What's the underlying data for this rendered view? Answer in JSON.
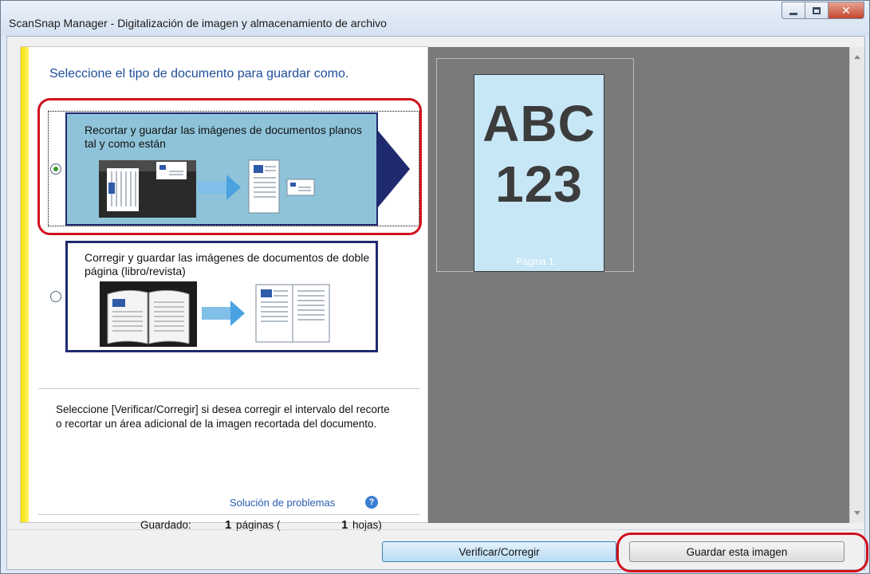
{
  "window": {
    "title": "ScanSnap Manager - Digitalización de imagen y almacenamiento de archivo"
  },
  "panel": {
    "prompt": "Seleccione el tipo de documento para guardar como.",
    "options": [
      {
        "label": "Recortar y guardar las imágenes de documentos planos tal y como están",
        "selected": true
      },
      {
        "label": "Corregir y guardar las imágenes de documentos de doble página (libro/revista)",
        "selected": false
      }
    ],
    "info": "Seleccione [Verificar/Corregir] si desea corregir el intervalo del recorte o recortar un área adicional de la imagen recortada del documento.",
    "help_link": "Solución de problemas",
    "help_icon": "?"
  },
  "status": {
    "saved_label": "Guardado:",
    "pages_count": "1",
    "pages_unit": "páginas (",
    "sheets_count": "1",
    "sheets_unit": "hojas)"
  },
  "preview": {
    "thumbnail_line1": "ABC",
    "thumbnail_line2": "123",
    "caption": "Página 1"
  },
  "buttons": {
    "verify": "Verificar/Corregir",
    "save": "Guardar esta imagen"
  },
  "colors": {
    "accent_yellow": "#f6e200",
    "selected_option_bg": "#8ec3d9",
    "option_border": "#1f2a6e",
    "highlight_red": "#d0101e",
    "preview_bg": "#7a7a7a"
  }
}
